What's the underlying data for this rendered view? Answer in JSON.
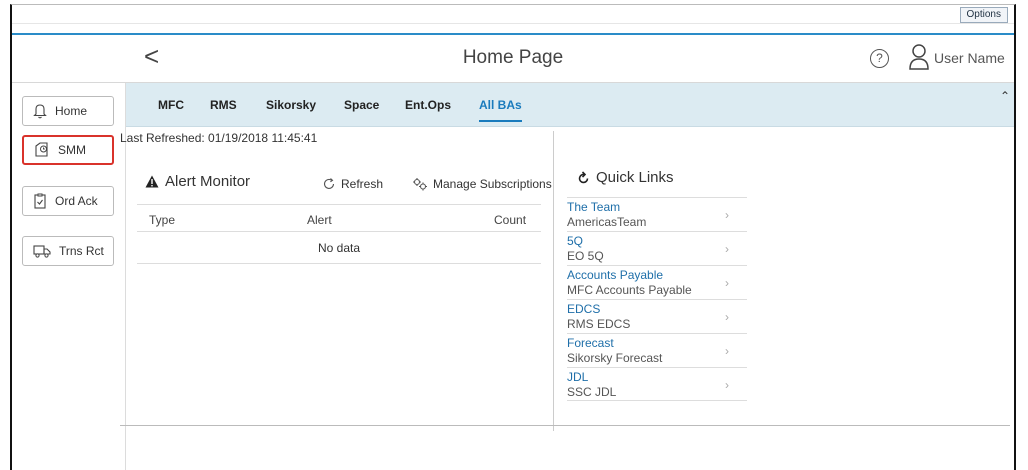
{
  "topbar": {
    "options_label": "Options"
  },
  "header": {
    "back_label": "<",
    "title": "Home Page",
    "help_label": "?",
    "user_name": "User Name"
  },
  "sidebar": {
    "items": [
      {
        "label": "Home",
        "icon": "bell-icon",
        "active": false
      },
      {
        "label": "SMM",
        "icon": "clock-doc-icon",
        "active": true
      },
      {
        "label": "Ord Ack",
        "icon": "clipboard-check-icon",
        "active": false
      },
      {
        "label": "Trns Rct",
        "icon": "truck-icon",
        "active": false
      }
    ]
  },
  "tabs": [
    {
      "label": "MFC"
    },
    {
      "label": "RMS"
    },
    {
      "label": "Sikorsky"
    },
    {
      "label": "Space"
    },
    {
      "label": "Ent.Ops"
    },
    {
      "label": "All BAs",
      "active": true
    }
  ],
  "status": {
    "last_refreshed": "Last Refreshed: 01/19/2018 11:45:41"
  },
  "alert_monitor": {
    "title": "Alert Monitor",
    "refresh_label": "Refresh",
    "manage_label": "Manage Subscriptions",
    "columns": [
      "Type",
      "Alert",
      "Count"
    ],
    "empty_text": "No data"
  },
  "quick_links": {
    "title": "Quick Links",
    "items": [
      {
        "name": "The Team",
        "sub": "AmericasTeam"
      },
      {
        "name": "5Q",
        "sub": "EO 5Q"
      },
      {
        "name": "Accounts Payable",
        "sub": "MFC Accounts Payable"
      },
      {
        "name": "EDCS",
        "sub": "RMS EDCS"
      },
      {
        "name": "Forecast",
        "sub": "Sikorsky Forecast"
      },
      {
        "name": "JDL",
        "sub": "SSC JDL"
      }
    ]
  },
  "colors": {
    "accent": "#1a7bbd",
    "tab_bar": "#dcebf2",
    "active_border": "#d9322b"
  }
}
